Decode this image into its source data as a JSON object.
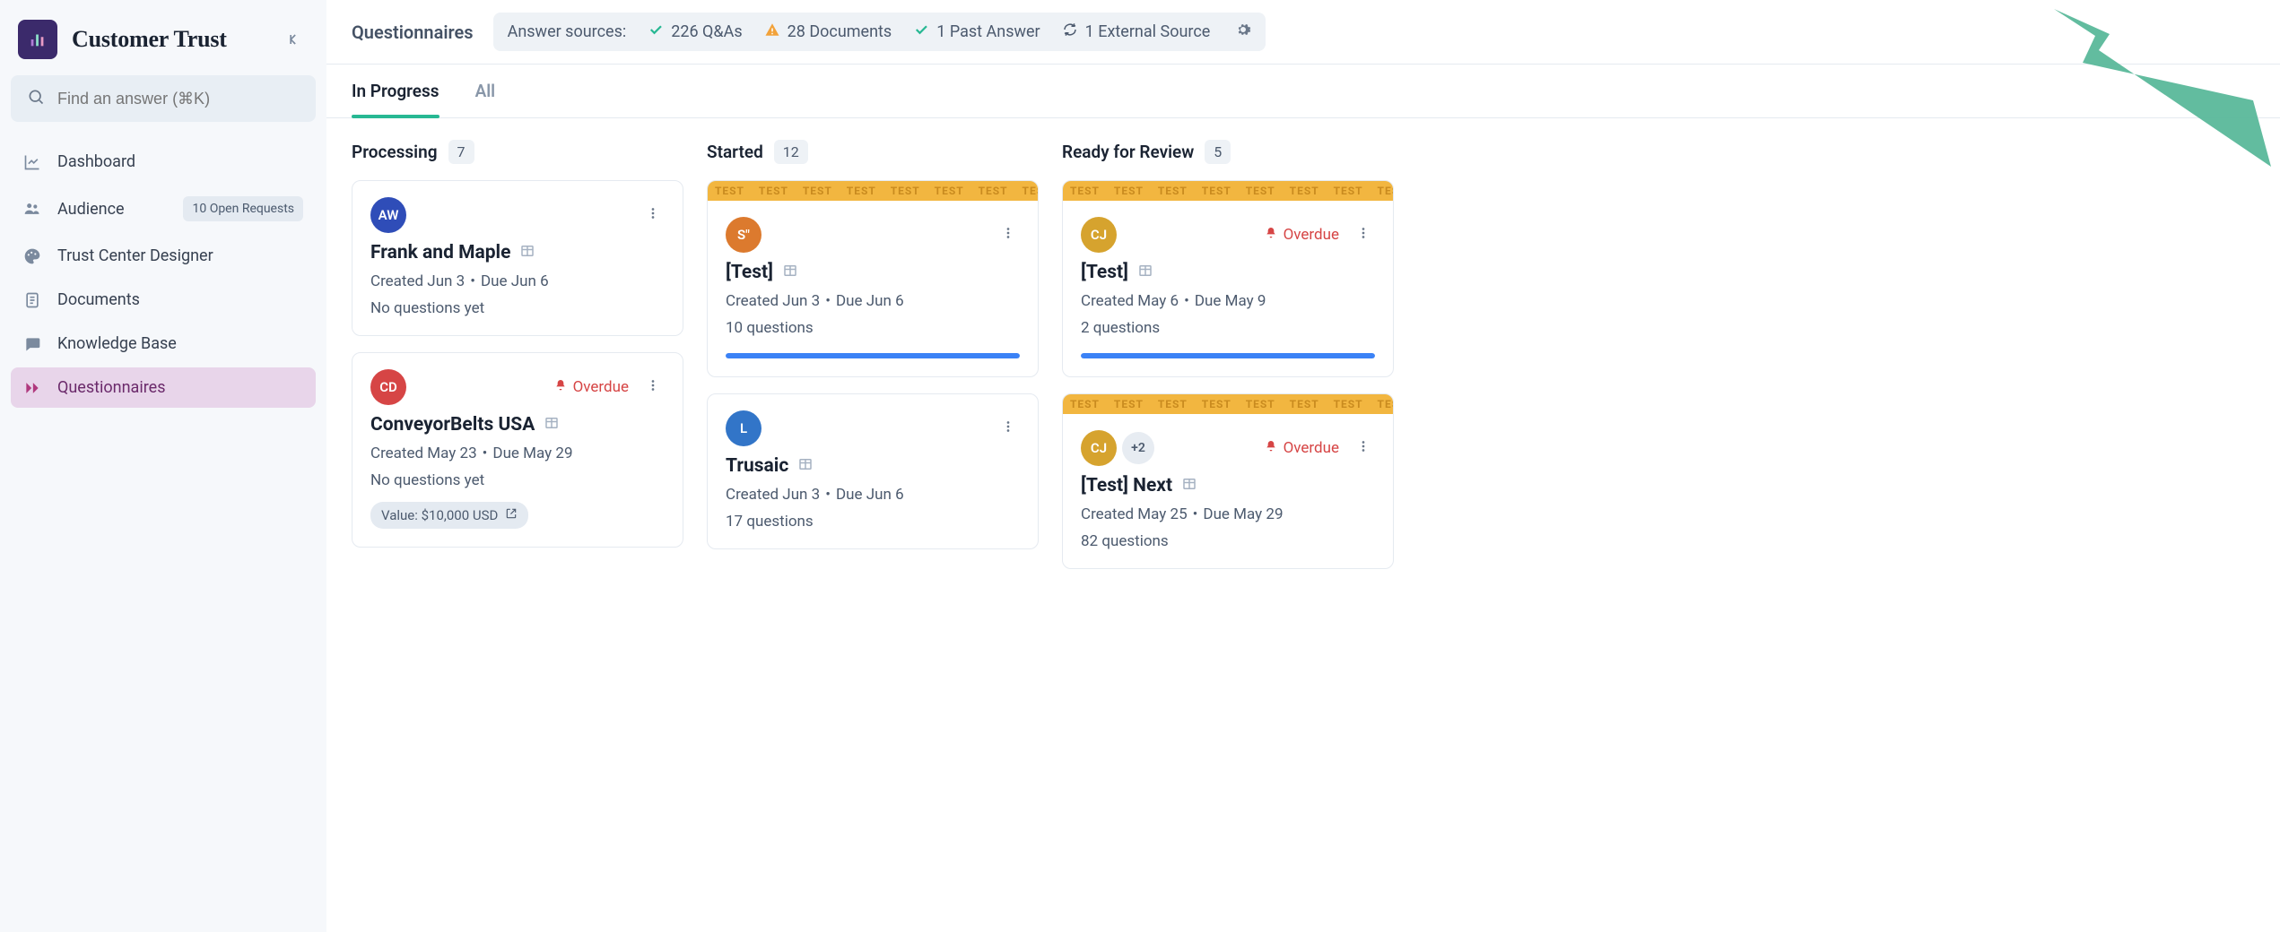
{
  "brand": {
    "title": "Customer Trust"
  },
  "search": {
    "placeholder": "Find an answer (⌘K)"
  },
  "nav": {
    "items": [
      {
        "label": "Dashboard",
        "icon": "chart"
      },
      {
        "label": "Audience",
        "icon": "users",
        "badge": "10 Open Requests"
      },
      {
        "label": "Trust Center Designer",
        "icon": "palette"
      },
      {
        "label": "Documents",
        "icon": "doc"
      },
      {
        "label": "Knowledge Base",
        "icon": "chat"
      },
      {
        "label": "Questionnaires",
        "icon": "forward",
        "active": true
      }
    ]
  },
  "topbar": {
    "title": "Questionnaires",
    "sources_label": "Answer sources:",
    "sources": [
      {
        "icon": "check",
        "color": "#27b893",
        "text": "226 Q&As"
      },
      {
        "icon": "warn",
        "color": "#f2a23a",
        "text": "28 Documents"
      },
      {
        "icon": "check",
        "color": "#27b893",
        "text": "1 Past Answer"
      },
      {
        "icon": "sync",
        "color": "#4c5a6e",
        "text": "1 External Source"
      }
    ]
  },
  "tabs": [
    {
      "label": "In Progress",
      "active": true
    },
    {
      "label": "All"
    }
  ],
  "columns": [
    {
      "title": "Processing",
      "count": "7",
      "cards": [
        {
          "avatar": {
            "text": "AW",
            "color": "#2f4db8"
          },
          "title": "Frank and Maple",
          "created": "Created Jun 3",
          "due": "Due Jun 6",
          "sub": "No questions yet"
        },
        {
          "avatar": {
            "text": "CD",
            "color": "#d64545"
          },
          "overdue": true,
          "overdue_label": "Overdue",
          "title": "ConveyorBelts USA",
          "created": "Created May 23",
          "due": "Due May 29",
          "sub": "No questions yet",
          "value": "Value: $10,000 USD"
        }
      ]
    },
    {
      "title": "Started",
      "count": "12",
      "cards": [
        {
          "test": true,
          "avatar": {
            "text": "S\"",
            "color": "#dc7a2e"
          },
          "title": "[Test]",
          "created": "Created Jun 3",
          "due": "Due Jun 6",
          "sub": "10 questions",
          "progress": 100
        },
        {
          "avatar": {
            "text": "L",
            "color": "#3275c8"
          },
          "title": "Trusaic",
          "created": "Created Jun 3",
          "due": "Due Jun 6",
          "sub": "17 questions"
        }
      ]
    },
    {
      "title": "Ready for Review",
      "count": "5",
      "cards": [
        {
          "test": true,
          "avatar": {
            "text": "CJ",
            "color": "#d6a32e"
          },
          "overdue": true,
          "overdue_label": "Overdue",
          "title": "[Test]",
          "created": "Created May 6",
          "due": "Due May 9",
          "sub": "2 questions",
          "progress": 100
        },
        {
          "test": true,
          "avatar": {
            "text": "CJ",
            "color": "#d6a32e"
          },
          "extra_avatar": "+2",
          "overdue": true,
          "overdue_label": "Overdue",
          "title": "[Test] Next",
          "created": "Created May 25",
          "due": "Due May 29",
          "sub": "82 questions"
        }
      ]
    }
  ]
}
